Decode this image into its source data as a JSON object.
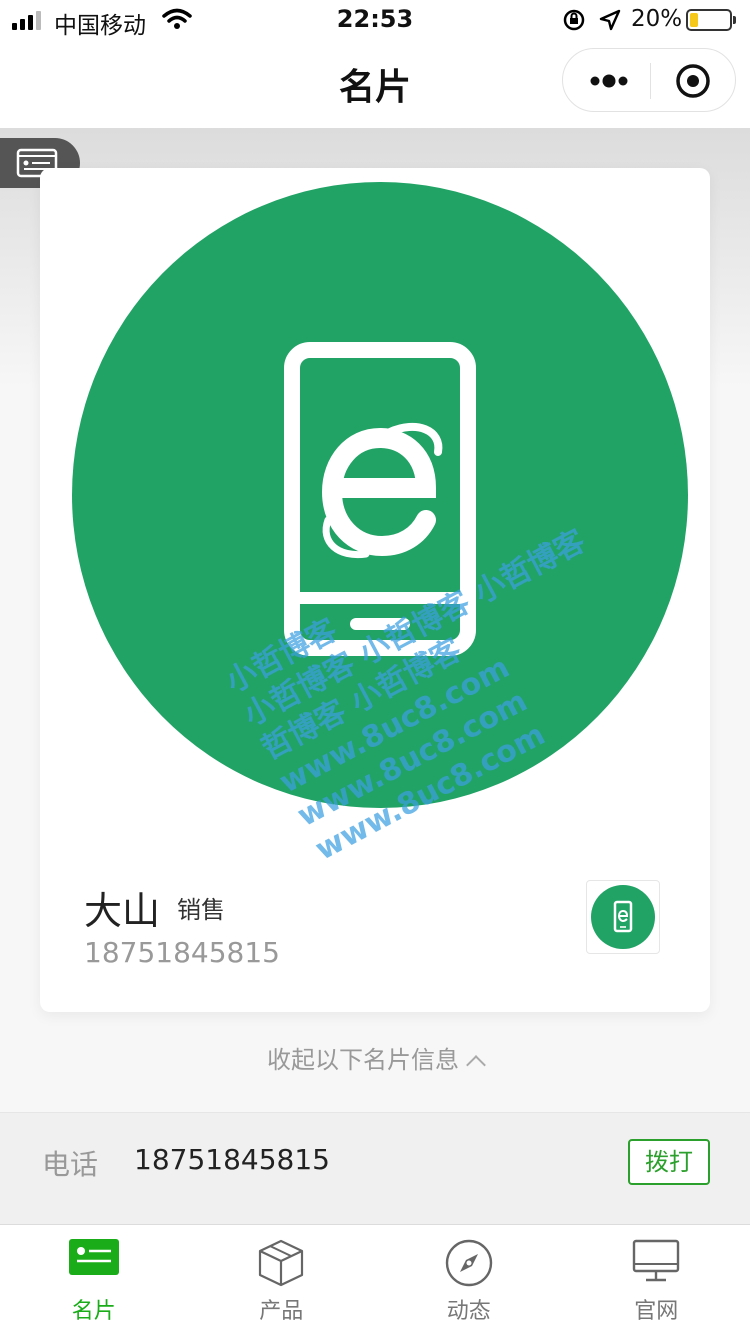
{
  "status_bar": {
    "carrier": "中国移动",
    "time": "22:53",
    "battery_percent": "20%",
    "battery_level": 0.2
  },
  "nav": {
    "title": "名片"
  },
  "card": {
    "name": "大山",
    "role": "销售",
    "phone": "18751845815",
    "watermark_lines": [
      "小哲博客",
      "小哲博客 小哲博客 小哲博客",
      "哲博客 小哲博客",
      "www.8uc8.com",
      "www.8uc8.com",
      "www.8uc8.com"
    ]
  },
  "collapse": {
    "label": "收起以下名片信息"
  },
  "info": {
    "label": "电话",
    "value": "18751845815",
    "action": "拨打"
  },
  "tabs": [
    {
      "label": "名片",
      "icon": "card-icon",
      "active": true
    },
    {
      "label": "产品",
      "icon": "box-icon",
      "active": false
    },
    {
      "label": "动态",
      "icon": "compass-icon",
      "active": false
    },
    {
      "label": "官网",
      "icon": "monitor-icon",
      "active": false
    }
  ],
  "colors": {
    "brand_green": "#21a366",
    "active_tab": "#1aad19",
    "dial_border": "#2ca02c"
  }
}
